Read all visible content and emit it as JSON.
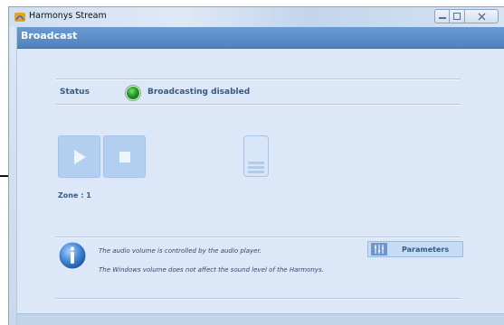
{
  "window": {
    "title": "Harmonys Stream"
  },
  "header": {
    "title": "Broadcast"
  },
  "status": {
    "label": "Status",
    "text": "Broadcasting disabled",
    "indicator_color": "#1f9a1f"
  },
  "controls": {
    "play_icon": "play-icon",
    "stop_icon": "stop-icon",
    "volume_icon": "volume-meter-icon"
  },
  "zone": {
    "label": "Zone : 1"
  },
  "info": {
    "line1": "The audio volume is controlled by the audio player.",
    "line2": "The Windows volume does not affect the sound level of the Harmonys."
  },
  "parameters": {
    "label": "Parameters"
  },
  "colors": {
    "header": "#4f82c0",
    "panel": "#dce8f8",
    "accent": "#355a85"
  }
}
